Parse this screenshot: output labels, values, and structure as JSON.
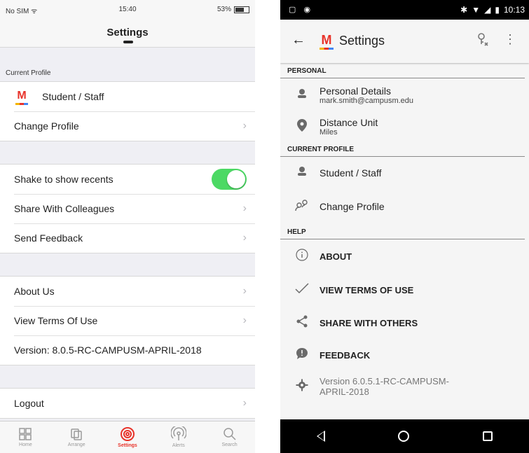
{
  "ios": {
    "status": {
      "carrier": "No SIM ᯤ",
      "time": "15:40",
      "battery": "53%"
    },
    "title": "Settings",
    "current_profile_label": "Current Profile",
    "profile_name": "Student / Staff",
    "change_profile": "Change Profile",
    "shake_label": "Shake to show recents",
    "shake_enabled": true,
    "share_colleagues": "Share With Colleagues",
    "send_feedback": "Send Feedback",
    "about_us": "About Us",
    "terms": "View Terms Of Use",
    "version": "Version: 8.0.5-RC-CAMPUSM-APRIL-2018",
    "logout": "Logout",
    "tabs": [
      {
        "label": "Home",
        "icon": "grid-icon"
      },
      {
        "label": "Arrange",
        "icon": "layers-icon"
      },
      {
        "label": "Settings",
        "icon": "settings-icon",
        "active": true
      },
      {
        "label": "Alerts",
        "icon": "broadcast-icon"
      },
      {
        "label": "Search",
        "icon": "search-icon"
      }
    ],
    "accent_color": "#e8332a",
    "toggle_color": "#4cd964"
  },
  "android": {
    "status": {
      "time": "10:13"
    },
    "title": "Settings",
    "sections": {
      "personal": "PERSONAL",
      "current_profile": "CURRENT PROFILE",
      "help": "HELP"
    },
    "personal_details": "Personal Details",
    "email": "mark.smith@campusm.edu",
    "distance_unit": "Distance Unit",
    "distance_value": "Miles",
    "profile_name": "Student / Staff",
    "change_profile": "Change Profile",
    "about": "ABOUT",
    "terms": "VIEW TERMS OF USE",
    "share": "SHARE WITH OTHERS",
    "feedback": "FEEDBACK",
    "version_line1": "Version 6.0.5.1-RC-CAMPUSM-",
    "version_line2": "APRIL-2018"
  }
}
